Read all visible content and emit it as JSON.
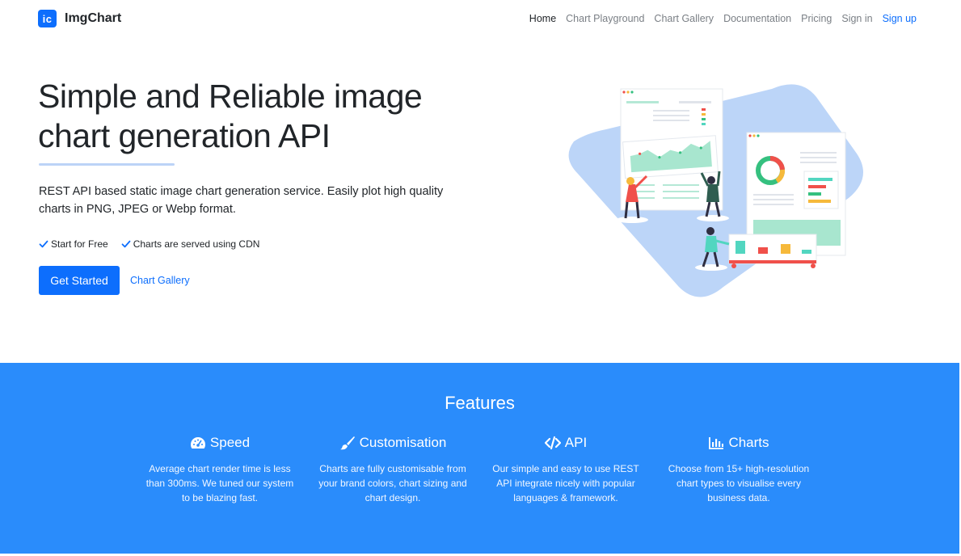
{
  "nav": {
    "logo_text": "ic",
    "brand": "ImgChart",
    "links": [
      "Home",
      "Chart Playground",
      "Chart Gallery",
      "Documentation",
      "Pricing",
      "Sign in"
    ],
    "signup": "Sign up"
  },
  "hero": {
    "title": "Simple and Reliable image chart generation API",
    "description": "REST API based static image chart generation service. Easily plot high quality charts in PNG, JPEG or Webp format.",
    "checks": [
      "Start for Free",
      "Charts are served using CDN"
    ],
    "primary_button": "Get Started",
    "secondary_link": "Chart Gallery"
  },
  "features": {
    "title": "Features",
    "items": [
      {
        "icon": "speedometer-icon",
        "title": "Speed",
        "text": "Average chart render time is less than 300ms. We tuned our system to be blazing fast."
      },
      {
        "icon": "paint-brush-icon",
        "title": "Customisation",
        "text": "Charts are fully customisable from your brand colors, chart sizing and chart design."
      },
      {
        "icon": "code-icon",
        "title": "API",
        "text": "Our simple and easy to use REST API integrate nicely with popular languages & framework."
      },
      {
        "icon": "bar-chart-icon",
        "title": "Charts",
        "text": "Choose from 15+ high-resolution chart types to visualise every business data."
      }
    ]
  },
  "colors": {
    "primary": "#0d6efd",
    "features_bg": "#2a8cfb",
    "illustration_bg": "#bcd5f8"
  }
}
